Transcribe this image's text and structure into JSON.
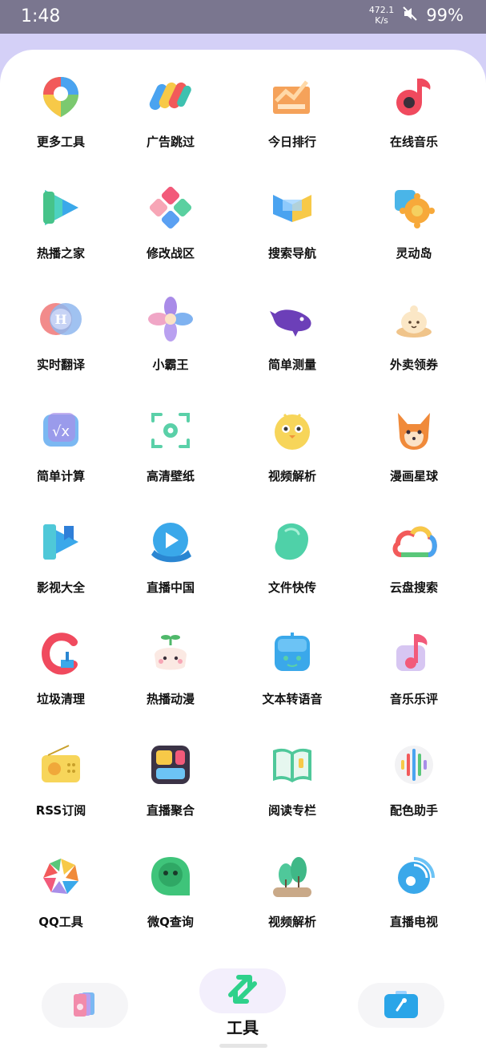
{
  "status": {
    "time": "1:48",
    "speed_value": "472.1",
    "speed_unit": "K/s",
    "battery": "99%"
  },
  "tools": [
    {
      "label": "更多工具",
      "icon": "map-pin-icon"
    },
    {
      "label": "广告跳过",
      "icon": "color-cards-icon"
    },
    {
      "label": "今日排行",
      "icon": "trending-chart-icon"
    },
    {
      "label": "在线音乐",
      "icon": "music-note-icon"
    },
    {
      "label": "热播之家",
      "icon": "play-triangle-icon"
    },
    {
      "label": "修改战区",
      "icon": "diamond-tiles-icon"
    },
    {
      "label": "搜索导航",
      "icon": "ribbon-flag-icon"
    },
    {
      "label": "灵动岛",
      "icon": "puzzle-gear-icon"
    },
    {
      "label": "实时翻译",
      "icon": "translate-h-icon"
    },
    {
      "label": "小霸王",
      "icon": "pinwheel-icon"
    },
    {
      "label": "简单测量",
      "icon": "whale-icon"
    },
    {
      "label": "外卖领券",
      "icon": "bun-icon"
    },
    {
      "label": "简单计算",
      "icon": "sqrt-calculator-icon"
    },
    {
      "label": "高清壁纸",
      "icon": "scan-flower-icon"
    },
    {
      "label": "视频解析",
      "icon": "chick-icon"
    },
    {
      "label": "漫画星球",
      "icon": "fox-icon"
    },
    {
      "label": "影视大全",
      "icon": "play-bookmark-icon"
    },
    {
      "label": "直播中国",
      "icon": "whale-play-icon"
    },
    {
      "label": "文件快传",
      "icon": "bean-icon"
    },
    {
      "label": "云盘搜索",
      "icon": "cloud-icon"
    },
    {
      "label": "垃圾清理",
      "icon": "broom-c-icon"
    },
    {
      "label": "热播动漫",
      "icon": "sprout-face-icon"
    },
    {
      "label": "文本转语音",
      "icon": "robot-box-icon"
    },
    {
      "label": "音乐乐评",
      "icon": "music-flag-icon"
    },
    {
      "label": "RSS订阅",
      "icon": "radio-icon"
    },
    {
      "label": "直播聚合",
      "icon": "widget-tiles-icon"
    },
    {
      "label": "阅读专栏",
      "icon": "open-book-icon"
    },
    {
      "label": "配色助手",
      "icon": "color-dots-icon"
    },
    {
      "label": "QQ工具",
      "icon": "aperture-icon"
    },
    {
      "label": "微Q查询",
      "icon": "chat-face-icon"
    },
    {
      "label": "视频解析",
      "icon": "tree-pot-icon"
    },
    {
      "label": "直播电视",
      "icon": "satellite-icon"
    }
  ],
  "nav": {
    "active_label": "工具",
    "items": [
      {
        "icon": "cards-icon"
      },
      {
        "icon": "swap-arrows-icon"
      },
      {
        "icon": "toolbox-icon"
      }
    ]
  },
  "colors": {
    "accent_green": "#2fd18b",
    "status_bar": "#7a768f",
    "background": "#d4d0f7"
  }
}
